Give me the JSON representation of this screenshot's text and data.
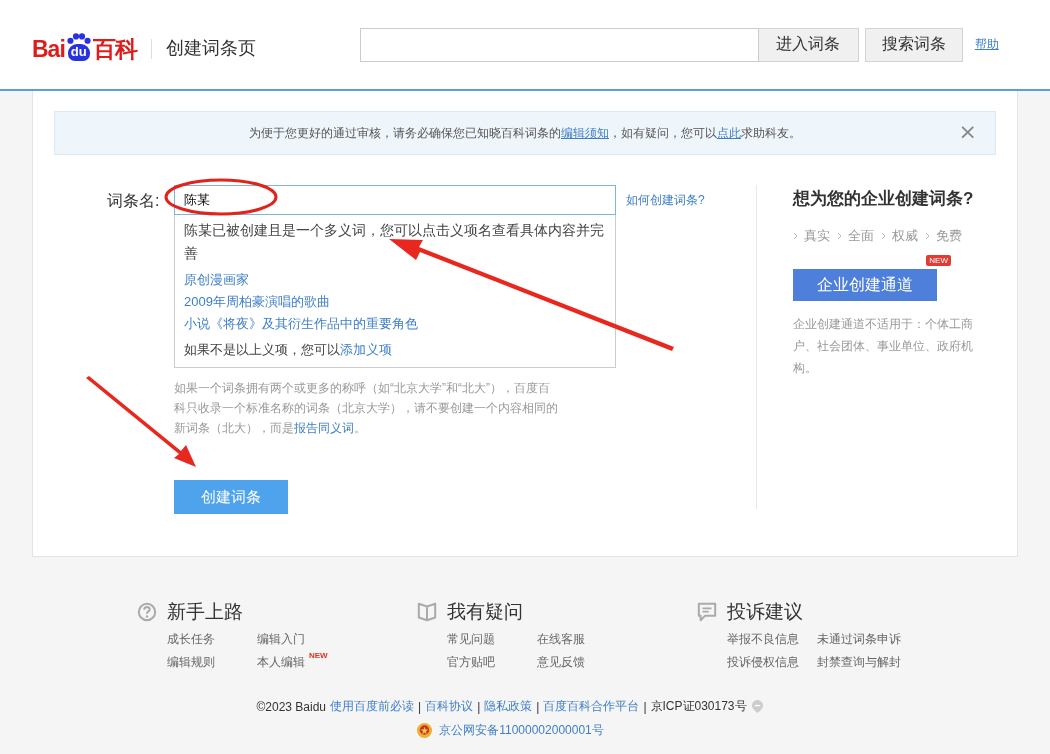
{
  "header": {
    "logo": {
      "left": "Bai",
      "paw": "du",
      "right": "百科"
    },
    "page_title": "创建词条页",
    "buttons": [
      "进入词条",
      "搜索词条"
    ],
    "help_link": "帮助"
  },
  "notice": {
    "parts": [
      {
        "text": "为便于您更好的通过审核，请务必确保您已知晓百科词条的",
        "kind": "text"
      },
      {
        "text": "编辑须知",
        "kind": "link"
      },
      {
        "text": "，如有疑问，您可以",
        "kind": "text"
      },
      {
        "text": "点此",
        "kind": "link"
      },
      {
        "text": "求助科友。",
        "kind": "text"
      }
    ],
    "close": "×"
  },
  "form": {
    "label": "词条名:",
    "value": "陈某",
    "how_link": "如何创建词条?",
    "dropdown": {
      "message": "陈某已被创建且是一个多义词，您可以点击义项名查看具体内容并完善",
      "senses": [
        "原创漫画家",
        "2009年周柏豪演唱的歌曲",
        "小说《将夜》及其衍生作品中的重要角色"
      ],
      "footer": "如果不是以上义项，您可以",
      "footer_link": "添加义项"
    },
    "help": "如果一个词条拥有两个或更多的称呼（如“北京大学”和“北大”），百度百科只收录一个标准名称的词条（北京大学），请不要创建一个内容相同的新词条（北大），而是",
    "help_link": "报告同义词",
    "help_end": "。",
    "submit": "创建词条"
  },
  "enterprise": {
    "title": "想为您的企业创建词条?",
    "features": [
      "真实",
      "全面",
      "权威",
      "免费"
    ],
    "button": "企业创建通道",
    "badge": "NEW",
    "note": "企业创建通道不适用于：个体工商户、社会团体、事业单位、政府机构。"
  },
  "footer": {
    "columns": [
      {
        "title": "新手上路",
        "links": [
          {
            "text": "成长任务"
          },
          {
            "text": "编辑入门"
          },
          {
            "text": "编辑规则"
          },
          {
            "text": "本人编辑",
            "badge": "NEW"
          }
        ]
      },
      {
        "title": "我有疑问",
        "links": [
          {
            "text": "常见问题"
          },
          {
            "text": "在线客服"
          },
          {
            "text": "官方贴吧"
          },
          {
            "text": "意见反馈"
          }
        ]
      },
      {
        "title": "投诉建议",
        "links": [
          {
            "text": "举报不良信息"
          },
          {
            "text": "未通过词条申诉"
          },
          {
            "text": "投诉侵权信息"
          },
          {
            "text": "封禁查询与解封"
          }
        ]
      }
    ],
    "legal": [
      {
        "text": "©2023 Baidu",
        "kind": "text"
      },
      {
        "text": "使用百度前必读",
        "kind": "link"
      },
      {
        "text": "|",
        "kind": "sep"
      },
      {
        "text": "百科协议",
        "kind": "link"
      },
      {
        "text": "|",
        "kind": "sep"
      },
      {
        "text": "隐私政策",
        "kind": "link"
      },
      {
        "text": "|",
        "kind": "sep"
      },
      {
        "text": "百度百科合作平台",
        "kind": "link"
      },
      {
        "text": "|",
        "kind": "sep"
      },
      {
        "text": "京ICP证030173号",
        "kind": "text"
      }
    ],
    "police": "京公网安备11000002000001号"
  }
}
